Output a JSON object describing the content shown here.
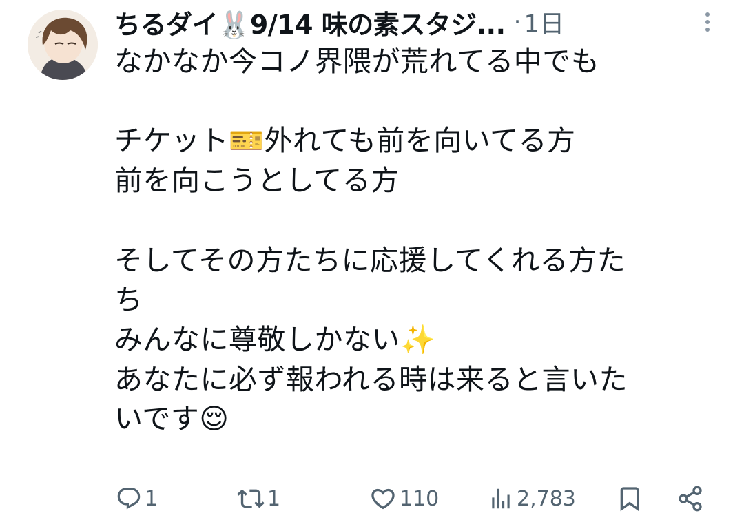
{
  "tweet": {
    "author": {
      "display_name": "ちるダイ🐰9/14 味の素スタジ...",
      "avatar_icon": "user-avatar-icon"
    },
    "separator": "·",
    "timestamp": "1日",
    "text": "なかなか今コノ界隈が荒れてる中でも\n\nチケット🎫外れても前を向いてる方\n前を向こうとしてる方\n\nそしてその方たちに応援してくれる方た\nち\nみんなに尊敬しかない✨\nあなたに必ず報われる時は来ると言いた\nいです😌"
  },
  "actions": {
    "reply": {
      "icon": "reply-icon",
      "count": "1"
    },
    "retweet": {
      "icon": "retweet-icon",
      "count": "1"
    },
    "like": {
      "icon": "heart-icon",
      "count": "110"
    },
    "views": {
      "icon": "views-icon",
      "count": "2,783"
    },
    "bookmark": {
      "icon": "bookmark-icon"
    },
    "share": {
      "icon": "share-icon"
    }
  },
  "colors": {
    "text": "#0f1419",
    "secondary": "#536471",
    "more_dots": "#8b98a5"
  }
}
